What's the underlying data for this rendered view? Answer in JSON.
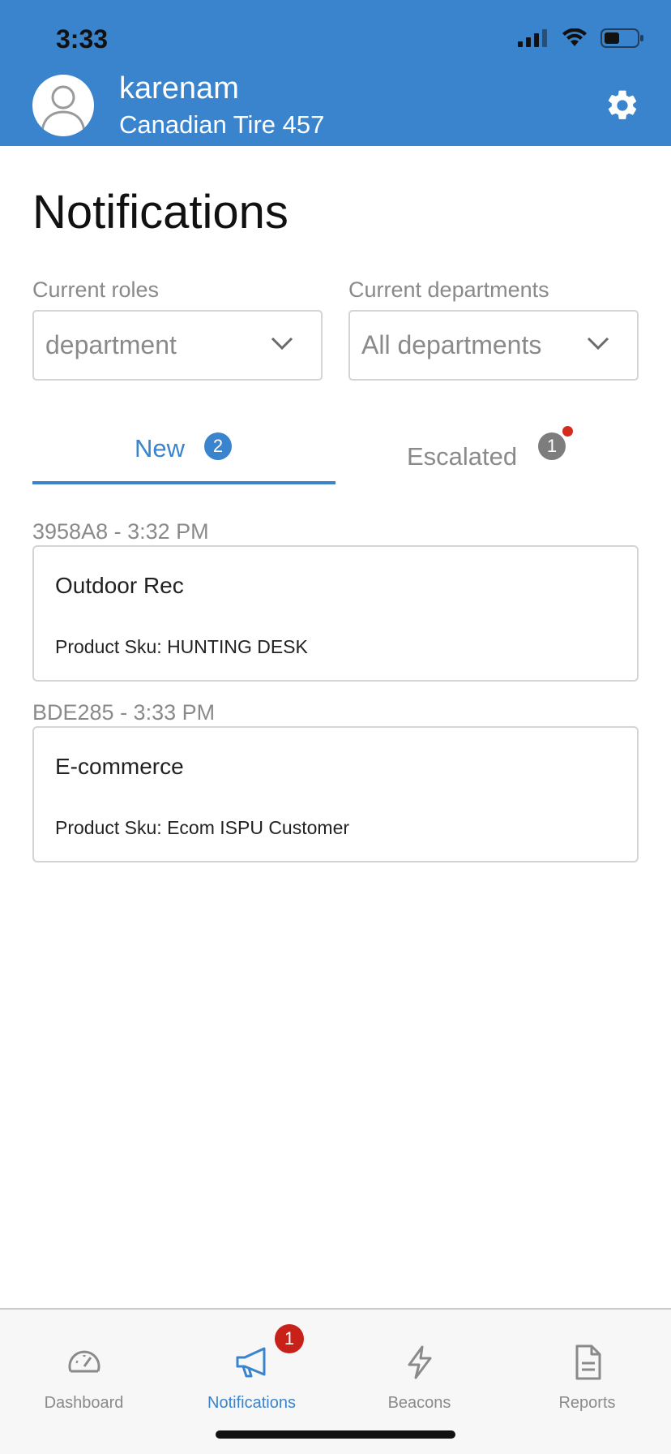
{
  "status_bar": {
    "time": "3:33"
  },
  "header": {
    "username": "karenam",
    "store": "Canadian Tire 457"
  },
  "page": {
    "title": "Notifications"
  },
  "filters": {
    "roles": {
      "label": "Current roles",
      "value": "department"
    },
    "departments": {
      "label": "Current departments",
      "value": "All departments"
    }
  },
  "tabs": [
    {
      "label": "New",
      "count": "2",
      "active": true
    },
    {
      "label": "Escalated",
      "count": "1",
      "active": false
    }
  ],
  "notifications": [
    {
      "meta": "3958A8 - 3:32 PM",
      "department": "Outdoor Rec",
      "sku": "Product Sku: HUNTING DESK"
    },
    {
      "meta": "BDE285 - 3:33 PM",
      "department": "E-commerce",
      "sku": "Product Sku: Ecom ISPU Customer"
    }
  ],
  "bottom_nav": {
    "items": [
      {
        "label": "Dashboard",
        "icon": "speedometer-icon"
      },
      {
        "label": "Notifications",
        "icon": "megaphone-icon",
        "badge": "1"
      },
      {
        "label": "Beacons",
        "icon": "lightning-icon"
      },
      {
        "label": "Reports",
        "icon": "document-icon"
      }
    ]
  },
  "colors": {
    "brand": "#3a84cd",
    "badge_red": "#c8211a",
    "muted_text": "#8a8a8a",
    "border": "#d4d4d4"
  }
}
